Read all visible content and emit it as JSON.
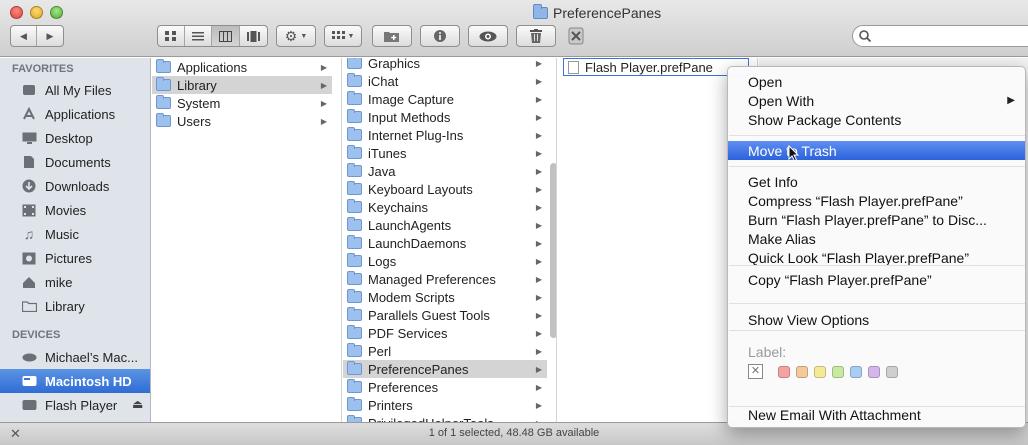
{
  "window": {
    "title": "PreferencePanes"
  },
  "toolbar": {
    "back_glyph": "◀",
    "forward_glyph": "▶",
    "view_icons": [
      "icon-view-icon",
      "list-view-icon",
      "column-view-icon",
      "coverflow-view-icon"
    ],
    "active_view": "column-view"
  },
  "sidebar": {
    "favorites_header": "FAVORITES",
    "devices_header": "DEVICES",
    "favorites": [
      {
        "label": "All My Files",
        "icon": "all-files-icon"
      },
      {
        "label": "Applications",
        "icon": "applications-icon"
      },
      {
        "label": "Desktop",
        "icon": "desktop-icon"
      },
      {
        "label": "Documents",
        "icon": "documents-icon"
      },
      {
        "label": "Downloads",
        "icon": "downloads-icon"
      },
      {
        "label": "Movies",
        "icon": "movies-icon"
      },
      {
        "label": "Music",
        "icon": "music-icon"
      },
      {
        "label": "Pictures",
        "icon": "pictures-icon"
      },
      {
        "label": "mike",
        "icon": "home-icon"
      },
      {
        "label": "Library",
        "icon": "folder-icon"
      }
    ],
    "devices": [
      {
        "label": "Michael’s Mac...",
        "icon": "computer-icon"
      },
      {
        "label": "Macintosh HD",
        "icon": "hard-drive-icon",
        "selected": true
      },
      {
        "label": "Flash Player",
        "icon": "disk-image-icon"
      }
    ]
  },
  "column1": {
    "items": [
      "Applications",
      "Library",
      "System",
      "Users"
    ],
    "selected_index": 1
  },
  "column2": {
    "items": [
      "Graphics",
      "iChat",
      "Image Capture",
      "Input Methods",
      "Internet Plug-Ins",
      "iTunes",
      "Java",
      "Keyboard Layouts",
      "Keychains",
      "LaunchAgents",
      "LaunchDaemons",
      "Logs",
      "Managed Preferences",
      "Modem Scripts",
      "Parallels Guest Tools",
      "PDF Services",
      "Perl",
      "PreferencePanes",
      "Preferences",
      "Printers",
      "PrivilegedHelperTools"
    ],
    "selected_index": 17
  },
  "column3": {
    "items": [
      "Flash Player.prefPane"
    ]
  },
  "context_menu": {
    "groups": [
      [
        "Open",
        "Open With",
        "Show Package Contents"
      ],
      [
        "Move to Trash"
      ],
      [
        "Get Info",
        "Compress “Flash Player.prefPane”",
        "Burn “Flash Player.prefPane” to Disc...",
        "Make Alias",
        "Quick Look “Flash Player.prefPane”"
      ],
      [
        "Copy “Flash Player.prefPane”"
      ],
      [
        "Show View Options"
      ]
    ],
    "highlighted": "Move to Trash",
    "label_heading": "Label:",
    "label_colors": [
      "#f3a3a3",
      "#f6c99a",
      "#f3ea98",
      "#c8e9a0",
      "#a9cdf3",
      "#d3b6ec",
      "#cfcfcf"
    ],
    "new_email": "New Email With Attachment"
  },
  "status": {
    "text": "1 of 1 selected, 48.48 GB available"
  },
  "colors": {
    "selection_blue": "#3a74d9",
    "sidebar_bg": "#dfe4ea"
  }
}
